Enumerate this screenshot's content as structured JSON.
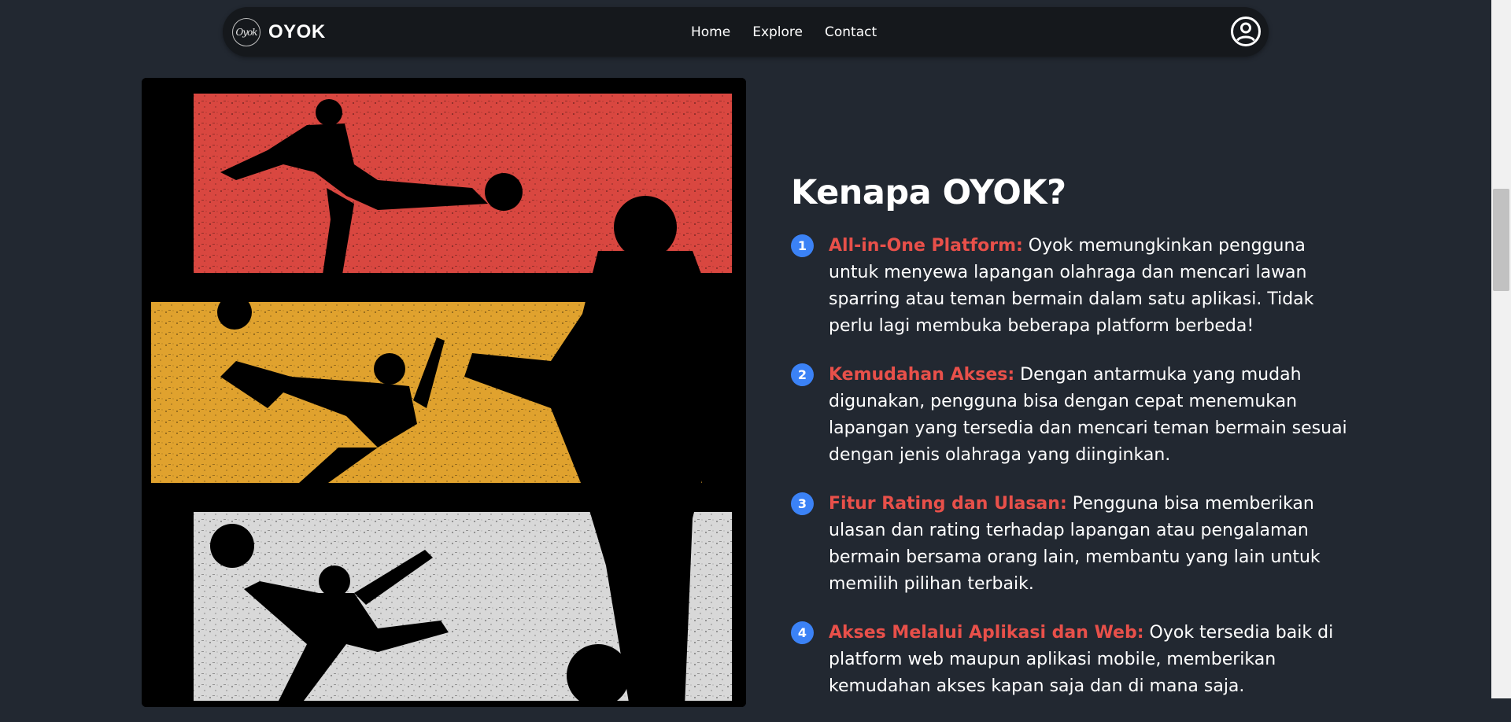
{
  "navbar": {
    "logo_text": "Oyok",
    "brand": "OYOK",
    "links": [
      "Home",
      "Explore",
      "Contact"
    ]
  },
  "hero": {
    "panel_colors": [
      "#d94740",
      "#e0a22e",
      "#d8d8d8"
    ]
  },
  "section": {
    "title": "Kenapa OYOK?",
    "items": [
      {
        "number": "1",
        "title": "All-in-One Platform:",
        "text": " Oyok memungkinkan pengguna untuk menyewa lapangan olahraga dan mencari lawan sparring atau teman bermain dalam satu aplikasi. Tidak perlu lagi membuka beberapa platform berbeda!"
      },
      {
        "number": "2",
        "title": "Kemudahan Akses:",
        "text": " Dengan antarmuka yang mudah digunakan, pengguna bisa dengan cepat menemukan lapangan yang tersedia dan mencari teman bermain sesuai dengan jenis olahraga yang diinginkan."
      },
      {
        "number": "3",
        "title": "Fitur Rating dan Ulasan:",
        "text": " Pengguna bisa memberikan ulasan dan rating terhadap lapangan atau pengalaman bermain bersama orang lain, membantu yang lain untuk memilih pilihan terbaik."
      },
      {
        "number": "4",
        "title": "Akses Melalui Aplikasi dan Web:",
        "text": " Oyok tersedia baik di platform web maupun aplikasi mobile, memberikan kemudahan akses kapan saja dan di mana saja."
      }
    ]
  },
  "colors": {
    "background": "#222831",
    "navbar": "#15181c",
    "accent": "#e8504a",
    "badge": "#3b82f6"
  }
}
